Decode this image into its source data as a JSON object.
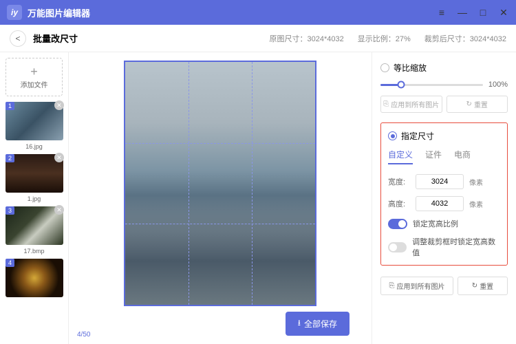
{
  "app": {
    "title": "万能图片编辑器"
  },
  "toolbar": {
    "page_title": "批量改尺寸",
    "info_original": "原图尺寸：3024*4032",
    "info_ratio": "显示比例：27%",
    "info_cropped": "裁剪后尺寸：3024*4032"
  },
  "sidebar": {
    "add_label": "添加文件",
    "items": [
      {
        "idx": "1",
        "name": "16.jpg"
      },
      {
        "idx": "2",
        "name": "1.jpg"
      },
      {
        "idx": "3",
        "name": "17.bmp"
      },
      {
        "idx": "4",
        "name": ""
      }
    ],
    "counter": "4/50"
  },
  "actions": {
    "save_all": "全部保存"
  },
  "panel": {
    "scale_label": "等比缩放",
    "slider_value": "100%",
    "apply_all": "应用到所有图片",
    "reset": "重置",
    "fixed_size": "指定尺寸",
    "tabs": {
      "custom": "自定义",
      "id": "证件",
      "ecom": "电商"
    },
    "width_label": "宽度:",
    "width_value": "3024",
    "height_label": "高度:",
    "height_value": "4032",
    "unit": "像素",
    "lock_ratio": "锁定宽高比例",
    "lock_crop": "调整裁剪框时锁定宽高数值",
    "apply_all2": "应用到所有图片",
    "reset2": "重置"
  }
}
